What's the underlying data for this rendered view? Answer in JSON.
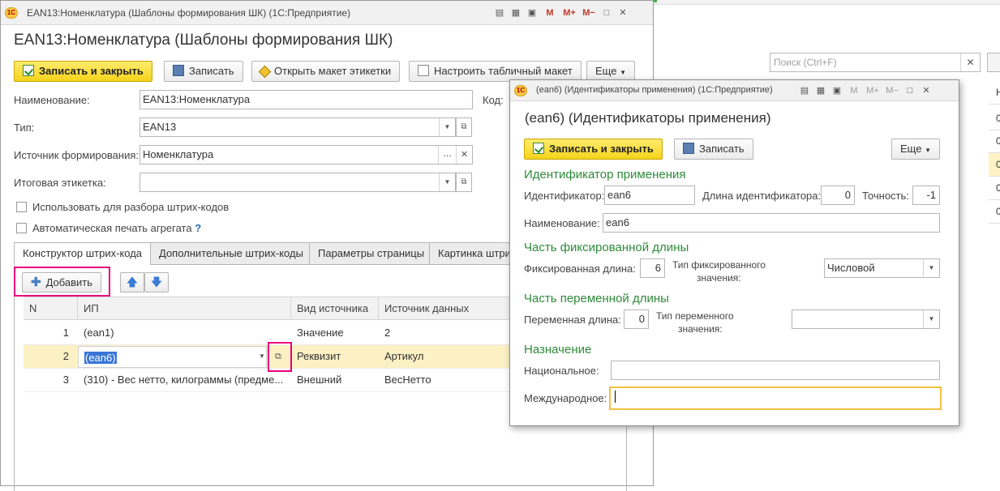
{
  "main": {
    "title": "EAN13:Номенклатура (Шаблоны формирования ШК)  (1С:Предприятие)",
    "heading": "EAN13:Номенклатура (Шаблоны формирования ШК)",
    "logo": "1С",
    "toolbar": {
      "save_close": "Записать и закрыть",
      "save": "Записать",
      "open_layout": "Открыть макет этикетки",
      "setup_layout": "Настроить табличный макет",
      "more": "Еще"
    },
    "fields": {
      "name_label": "Наименование:",
      "name_value": "EAN13:Номенклатура",
      "code_label": "Код:",
      "type_label": "Тип:",
      "type_value": "EAN13",
      "source_label": "Источник формирования:",
      "source_value": "Номенклатура",
      "final_label": "Итоговая этикетка:",
      "final_value": ""
    },
    "checkboxes": {
      "use_parse": "Использовать для разбора штрих-кодов",
      "auto_print": "Автоматическая печать агрегата",
      "help": "?"
    },
    "tabs": [
      "Конструктор штрих-кода",
      "Дополнительные штрих-коды",
      "Параметры страницы",
      "Картинка штри"
    ],
    "add_button": "Добавить",
    "table": {
      "headers": [
        "N",
        "ИП",
        "Вид источника",
        "Источник данных"
      ],
      "rows": [
        {
          "n": "1",
          "ip": "(ean1)",
          "kind": "Значение",
          "src": "2"
        },
        {
          "n": "2",
          "ip": "(ean6)",
          "kind": "Реквизит",
          "src": "Артикул"
        },
        {
          "n": "3",
          "ip": "(310) - Вес нетто, килограммы (предме...",
          "kind": "Внешний",
          "src": "ВесНетто"
        }
      ]
    }
  },
  "background": {
    "search_placeholder": "Поиск (Ctrl+F)",
    "col_arrow": "↓",
    "col_h": "Н",
    "cells": [
      "0",
      "0",
      "0",
      "0",
      "0"
    ]
  },
  "dialog": {
    "title": "(ean6) (Идентификаторы применения)  (1С:Предприятие)",
    "heading": "(ean6) (Идентификаторы применения)",
    "save_close": "Записать и закрыть",
    "save": "Записать",
    "more": "Еще",
    "sec_id": "Идентификатор применения",
    "id_label": "Идентификатор:",
    "id_value": "ean6",
    "len_label": "Длина идентификатора:",
    "len_value": "0",
    "prec_label": "Точность:",
    "prec_value": "-1",
    "name_label": "Наименование:",
    "name_value": "ean6",
    "sec_fixed": "Часть фиксированной длины",
    "fixed_len_label": "Фиксированная длина:",
    "fixed_len_value": "6",
    "fixed_type_label1": "Тип фиксированного",
    "fixed_type_label2": "значения:",
    "fixed_type_value": "Числовой",
    "sec_var": "Часть переменной длины",
    "var_len_label": "Переменная длина:",
    "var_len_value": "0",
    "var_type_label1": "Тип переменного",
    "var_type_label2": "значения:",
    "var_type_value": "",
    "sec_purpose": "Назначение",
    "national_label": "Национальное:",
    "national_value": "",
    "international_label": "Международное:",
    "international_value": ""
  }
}
